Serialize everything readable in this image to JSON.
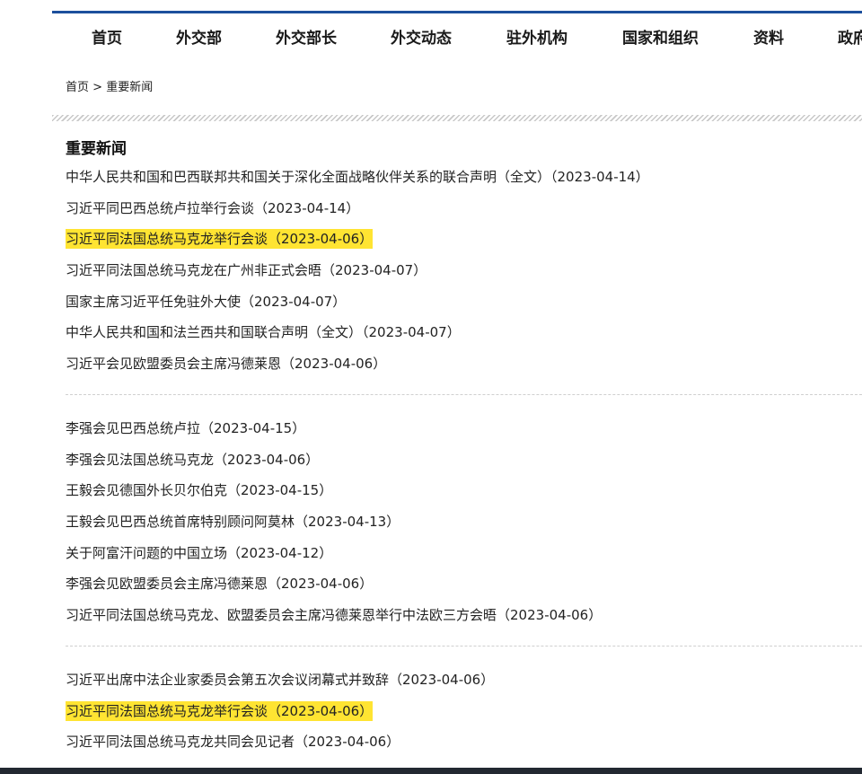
{
  "nav": {
    "items": [
      "首页",
      "外交部",
      "外交部长",
      "外交动态",
      "驻外机构",
      "国家和组织",
      "资料",
      "政府"
    ]
  },
  "breadcrumb": {
    "home": "首页",
    "separator": ">",
    "current": "重要新闻"
  },
  "section": {
    "title": "重要新闻"
  },
  "colors": {
    "nav_rule": "#1c4f9c",
    "highlight": "#ffe432"
  },
  "groups": [
    [
      {
        "title": "中华人民共和国和巴西联邦共和国关于深化全面战略伙伴关系的联合声明（全文）",
        "date": "（2023-04-14）",
        "highlighted": false
      },
      {
        "title": "习近平同巴西总统卢拉举行会谈",
        "date": "（2023-04-14）",
        "highlighted": false
      },
      {
        "title": "习近平同法国总统马克龙举行会谈",
        "date": "（2023-04-06）",
        "highlighted": true
      },
      {
        "title": "习近平同法国总统马克龙在广州非正式会晤",
        "date": "（2023-04-07）",
        "highlighted": false
      },
      {
        "title": "国家主席习近平任免驻外大使",
        "date": "（2023-04-07）",
        "highlighted": false
      },
      {
        "title": "中华人民共和国和法兰西共和国联合声明（全文）",
        "date": "（2023-04-07）",
        "highlighted": false
      },
      {
        "title": "习近平会见欧盟委员会主席冯德莱恩",
        "date": "（2023-04-06）",
        "highlighted": false
      }
    ],
    [
      {
        "title": "李强会见巴西总统卢拉",
        "date": "（2023-04-15）",
        "highlighted": false
      },
      {
        "title": "李强会见法国总统马克龙",
        "date": "（2023-04-06）",
        "highlighted": false
      },
      {
        "title": "王毅会见德国外长贝尔伯克",
        "date": "（2023-04-15）",
        "highlighted": false
      },
      {
        "title": "王毅会见巴西总统首席特别顾问阿莫林",
        "date": "（2023-04-13）",
        "highlighted": false
      },
      {
        "title": "关于阿富汗问题的中国立场",
        "date": "（2023-04-12）",
        "highlighted": false
      },
      {
        "title": "李强会见欧盟委员会主席冯德莱恩",
        "date": "（2023-04-06）",
        "highlighted": false
      },
      {
        "title": "习近平同法国总统马克龙、欧盟委员会主席冯德莱恩举行中法欧三方会晤",
        "date": "（2023-04-06）",
        "highlighted": false
      }
    ],
    [
      {
        "title": "习近平出席中法企业家委员会第五次会议闭幕式并致辞",
        "date": "（2023-04-06）",
        "highlighted": false
      },
      {
        "title": "习近平同法国总统马克龙举行会谈",
        "date": "（2023-04-06）",
        "highlighted": true
      },
      {
        "title": "习近平同法国总统马克龙共同会见记者",
        "date": "（2023-04-06）",
        "highlighted": false
      }
    ]
  ]
}
